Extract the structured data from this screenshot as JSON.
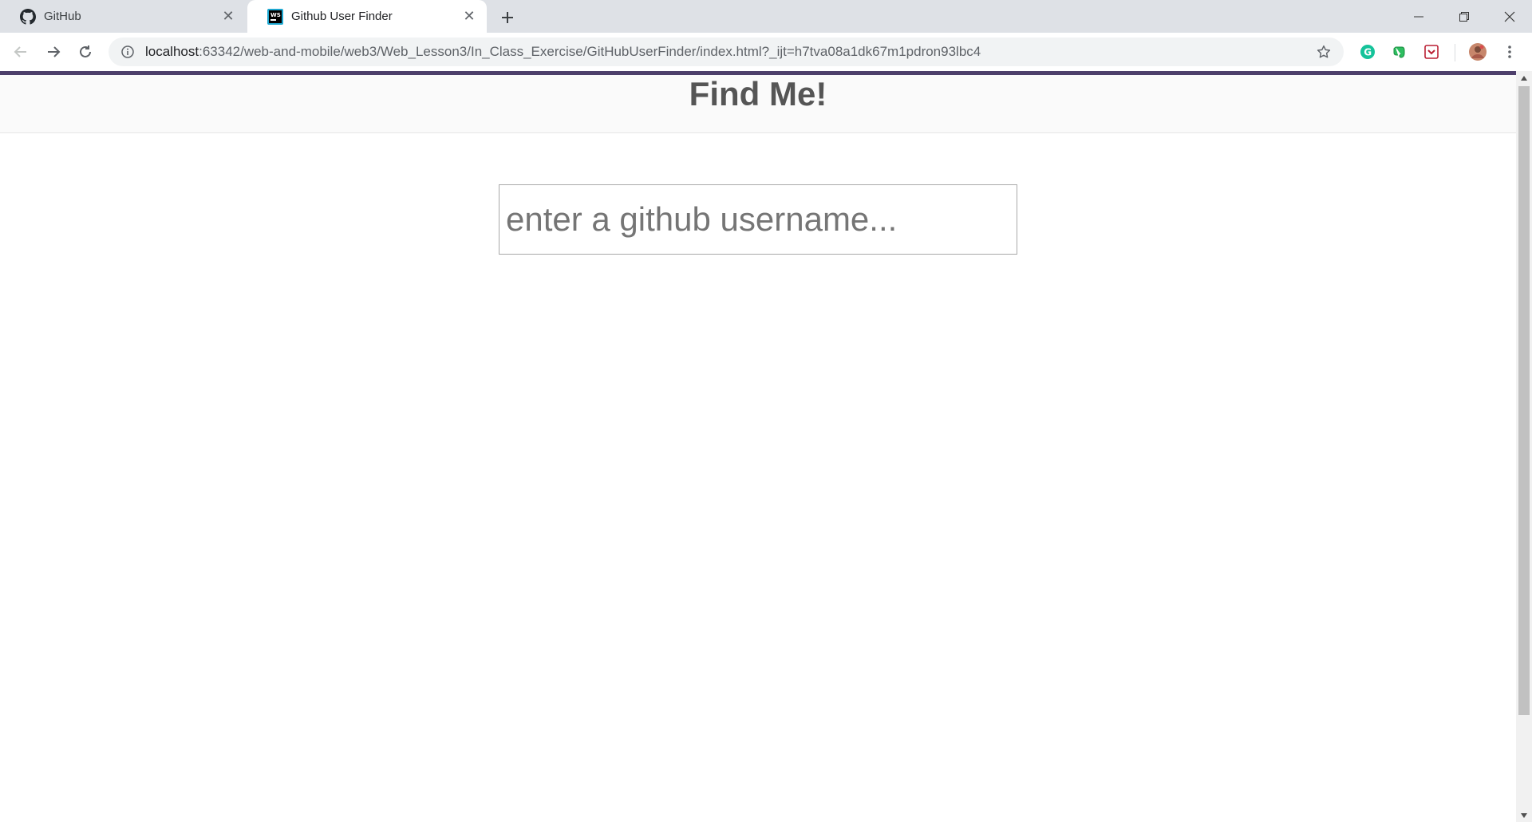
{
  "browser": {
    "tabs": [
      {
        "title": "GitHub",
        "icon": "github-icon",
        "active": false
      },
      {
        "title": "Github User Finder",
        "icon": "webstorm-icon",
        "active": true
      }
    ],
    "new_tab_label": "+",
    "address": {
      "host": "localhost",
      "path": ":63342/web-and-mobile/web3/Web_Lesson3/In_Class_Exercise/GitHubUserFinder/index.html?_ijt=h7tva08a1dk67m1pdron93lbc4"
    },
    "extensions": [
      "grammarly-icon",
      "evernote-icon",
      "pocket-icon"
    ]
  },
  "page": {
    "title": "Find Me!",
    "search": {
      "placeholder": "enter a github username...",
      "value": ""
    }
  },
  "colors": {
    "accent_bar": "#4d3f6b",
    "title_text": "#555555",
    "header_bg": "#fafafa"
  }
}
